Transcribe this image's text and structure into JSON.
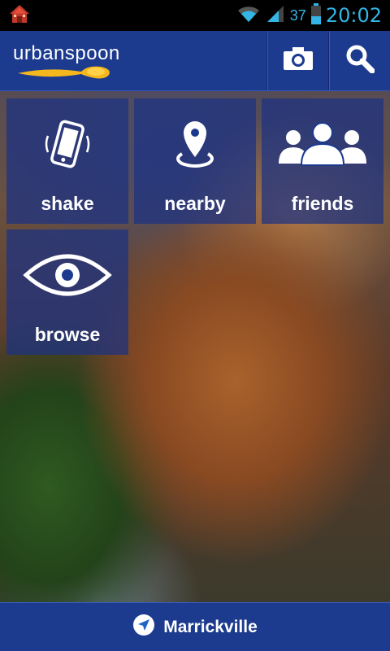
{
  "status_bar": {
    "battery_level": "37",
    "time": "20:02",
    "icons": [
      "home-notification-icon",
      "wifi-icon",
      "signal-icon",
      "battery-icon"
    ],
    "accent_color": "#33b5e5"
  },
  "header": {
    "logo": "urbanspoon",
    "actions": [
      {
        "name": "camera",
        "icon": "camera-icon"
      },
      {
        "name": "search",
        "icon": "search-icon"
      }
    ],
    "color": "#1c3a8e"
  },
  "tiles": [
    {
      "label": "shake",
      "icon": "phone-shake-icon"
    },
    {
      "label": "nearby",
      "icon": "location-pin-icon"
    },
    {
      "label": "friends",
      "icon": "people-group-icon"
    },
    {
      "label": "browse",
      "icon": "eye-icon"
    }
  ],
  "location_bar": {
    "icon": "location-arrow-icon",
    "label": "Marrickville"
  }
}
